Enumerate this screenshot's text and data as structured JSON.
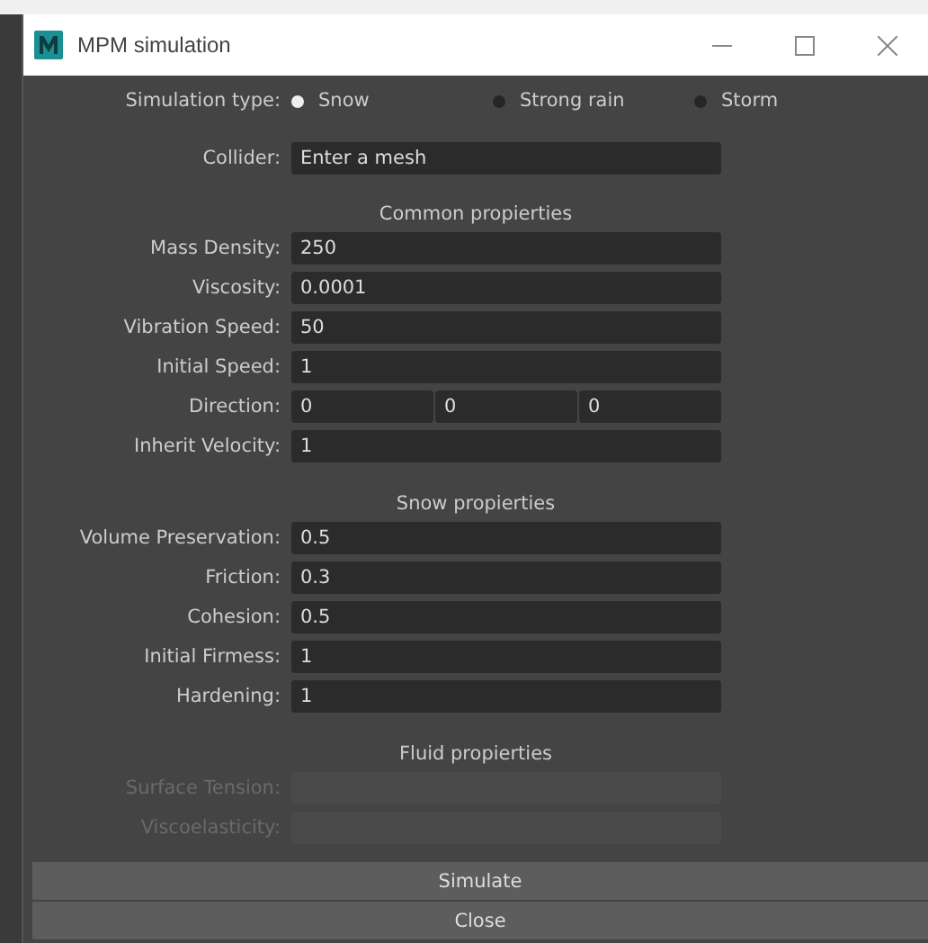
{
  "window": {
    "title": "MPM simulation"
  },
  "simulation_type": {
    "label": "Simulation type:",
    "options": [
      {
        "label": "Snow",
        "selected": true
      },
      {
        "label": "Strong rain",
        "selected": false
      },
      {
        "label": "Storm",
        "selected": false
      }
    ]
  },
  "collider": {
    "label": "Collider:",
    "value": "Enter a mesh"
  },
  "sections": [
    {
      "heading": "Common propierties",
      "fields": [
        {
          "kind": "text",
          "label": "Mass Density:",
          "value": "250",
          "disabled": false
        },
        {
          "kind": "text",
          "label": "Viscosity:",
          "value": "0.0001",
          "disabled": false
        },
        {
          "kind": "text",
          "label": "Vibration Speed:",
          "value": "50",
          "disabled": false
        },
        {
          "kind": "text",
          "label": "Initial Speed:",
          "value": "1",
          "disabled": false
        },
        {
          "kind": "vector",
          "label": "Direction:",
          "values": [
            "0",
            "0",
            "0"
          ],
          "disabled": false
        },
        {
          "kind": "text",
          "label": "Inherit Velocity:",
          "value": "1",
          "disabled": false
        }
      ]
    },
    {
      "heading": "Snow propierties",
      "fields": [
        {
          "kind": "text",
          "label": "Volume Preservation:",
          "value": "0.5",
          "disabled": false
        },
        {
          "kind": "text",
          "label": "Friction:",
          "value": "0.3",
          "disabled": false
        },
        {
          "kind": "text",
          "label": "Cohesion:",
          "value": "0.5",
          "disabled": false
        },
        {
          "kind": "text",
          "label": "Initial Firmess:",
          "value": "1",
          "disabled": false
        },
        {
          "kind": "text",
          "label": "Hardening:",
          "value": "1",
          "disabled": false
        }
      ]
    },
    {
      "heading": "Fluid propierties",
      "fields": [
        {
          "kind": "text",
          "label": "Surface Tension:",
          "disabled": true
        },
        {
          "kind": "text",
          "label": "Viscoelasticity:",
          "disabled": true
        }
      ]
    }
  ],
  "buttons": [
    "Simulate",
    "Close"
  ]
}
